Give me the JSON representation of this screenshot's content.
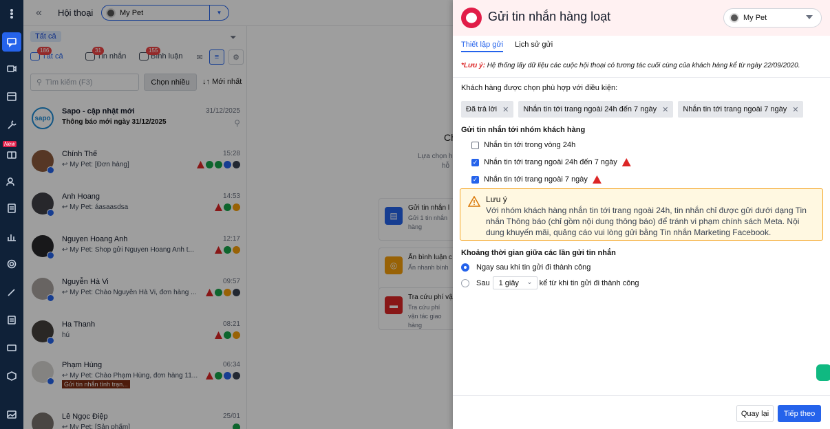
{
  "header": {
    "title": "Hội thoại",
    "page": "My Pet"
  },
  "list": {
    "chip_all": "Tất cả",
    "tabs": [
      {
        "label": "Tất cả",
        "badge": "186"
      },
      {
        "label": "Tin nhắn",
        "badge": "31"
      },
      {
        "label": "Bình luận",
        "badge": "155"
      }
    ],
    "search_placeholder": "Tìm kiếm (F3)",
    "choose_label": "Chọn nhiều",
    "sort_label": "Mới nhất",
    "conversations": [
      {
        "name": "Sapo - cập nhật mới",
        "preview": "Thông báo mới ngày 31/12/2025",
        "time": "31/12/2025"
      },
      {
        "name": "Chính Thế",
        "preview": "My Pet: [Đơn hàng]",
        "time": "15:28"
      },
      {
        "name": "Anh Hoang",
        "preview": "My Pet: áasaasdsa",
        "time": "14:53"
      },
      {
        "name": "Nguyen Hoang Anh",
        "preview": "My Pet: Shop gửi Nguyen Hoang Anh t...",
        "time": "12:17"
      },
      {
        "name": "Nguyễn Hà Vi",
        "preview": "My Pet: Chào Nguyễn Hà Vi, đơn hàng ...",
        "time": "09:57"
      },
      {
        "name": "Ha Thanh",
        "preview": "hú",
        "time": "08:21"
      },
      {
        "name": "Phạm Hùng",
        "preview": "My Pet: Chào Phạm Hùng, đơn hàng 11...",
        "time": "06:34",
        "label": "Gửi tin nhắn tình trạn..."
      },
      {
        "name": "Lê Ngọc Điệp",
        "preview": "My Pet: [Sản phẩm]",
        "time": "25/01"
      }
    ]
  },
  "center": {
    "partial_title": "Ch",
    "partial_l1": "Lựa chọn h",
    "partial_l2": "hỗ",
    "features": [
      {
        "title": "Gửi tin nhắn l",
        "desc": "Gửi 1 tin nhắn hàng"
      },
      {
        "title": "Ẩn bình luận c",
        "desc": "Ẩn nhanh bình"
      },
      {
        "title": "Tra cứu phí vậ",
        "desc": "Tra cứu phí vận tác giao hàng"
      }
    ]
  },
  "drawer": {
    "title": "Gửi tin nhắn hàng loạt",
    "page": "My Pet",
    "tabs": [
      "Thiết lập gửi",
      "Lịch sử gửi"
    ],
    "note_prefix": "*Lưu ý:",
    "note": "Hệ thống lấy dữ liệu các cuộc hội thoại có tương tác cuối cùng của khách hàng kể từ ngày 22/09/2020.",
    "conditions_label": "Khách hàng được chọn phù hợp với điều kiện:",
    "chips": [
      "Đã trả lời",
      "Nhắn tin tới trang ngoài 24h đến 7 ngày",
      "Nhắn tin tới trang ngoài 7 ngày"
    ],
    "group_label": "Gửi tin nhắn tới nhóm khách hàng",
    "options": [
      {
        "label": "Nhắn tin tới trong vòng 24h",
        "checked": false
      },
      {
        "label": "Nhắn tin tới trang ngoài 24h đến 7 ngày",
        "checked": true
      },
      {
        "label": "Nhắn tin tới trang ngoài 7 ngày",
        "checked": true
      }
    ],
    "alert_title": "Lưu ý",
    "alert_body": "Với nhóm khách hàng nhắn tin tới trang ngoài 24h, tin nhắn chỉ được gửi dưới dạng Tin nhắn Thông báo (chỉ gồm nội dung thông báo) để tránh vi phạm chính sách Meta. Nội dung khuyến mãi, quảng cáo vui lòng gửi bằng Tin nhắn Marketing Facebook.",
    "interval_label": "Khoảng thời gian giữa các lần gửi tin nhắn",
    "radio1": "Ngay sau khi tin gửi đi thành công",
    "radio2_prefix": "Sau",
    "radio2_value": "1 giây",
    "radio2_suffix": "kể từ khi tin gửi đi thành công",
    "back_label": "Quay lại",
    "next_label": "Tiếp theo"
  },
  "colors": {
    "primary": "#2563eb",
    "danger": "#dc2626",
    "warning": "#f5a524",
    "rail": "#0f2138"
  }
}
